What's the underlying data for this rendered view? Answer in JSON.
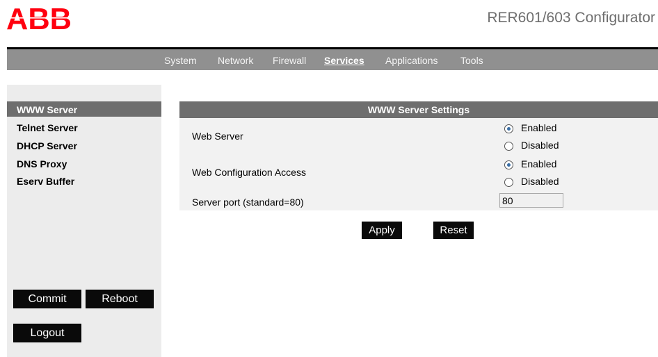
{
  "header": {
    "logo_text": "ABB",
    "app_title": "RER601/603 Configurator"
  },
  "nav": {
    "items": [
      {
        "label": "System"
      },
      {
        "label": "Network"
      },
      {
        "label": "Firewall"
      },
      {
        "label": "Services",
        "active": true
      },
      {
        "label": "Applications"
      },
      {
        "label": "Tools"
      }
    ]
  },
  "sidebar": {
    "items": [
      {
        "label": "WWW Server",
        "active": true
      },
      {
        "label": "Telnet Server"
      },
      {
        "label": "DHCP Server"
      },
      {
        "label": "DNS Proxy"
      },
      {
        "label": "Eserv Buffer"
      }
    ],
    "commit_label": "Commit",
    "reboot_label": "Reboot",
    "logout_label": "Logout"
  },
  "panel": {
    "title": "WWW Server Settings",
    "web_server": {
      "label": "Web Server",
      "options": [
        "Enabled",
        "Disabled"
      ],
      "selected": "Enabled"
    },
    "web_config_access": {
      "label": "Web Configuration Access",
      "options": [
        "Enabled",
        "Disabled"
      ],
      "selected": "Enabled"
    },
    "server_port": {
      "label": "Server port (standard=80)",
      "value": "80"
    },
    "apply_label": "Apply",
    "reset_label": "Reset"
  },
  "colors": {
    "nav_bg": "#909090",
    "header_bar_bg": "#6e6e6e",
    "sidebar_bg": "#ececec",
    "abb_red": "#ff000f",
    "button_bg": "#0a0a0a"
  }
}
